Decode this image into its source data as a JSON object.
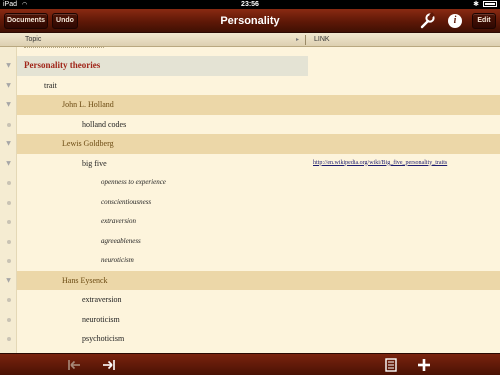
{
  "status_bar": {
    "device": "iPad",
    "time": "23:56"
  },
  "toolbar": {
    "documents_label": "Documents",
    "undo_label": "Undo",
    "title": "Personality",
    "edit_label": "Edit",
    "settings_icon": "wrench-icon",
    "info_icon": "info-icon"
  },
  "columns": {
    "topic": "Topic",
    "link": "LINK"
  },
  "colors": {
    "accent": "#6a1a08",
    "heading_text": "#a0261a",
    "band": "#ecd7a8",
    "heading_band": "#e4e3d4",
    "link": "#1a1a6e"
  },
  "rows": [
    {
      "text": "Personality theories",
      "link": ""
    },
    {
      "text": "trait",
      "link": ""
    },
    {
      "text": "John L. Holland",
      "link": ""
    },
    {
      "text": "holland codes",
      "link": ""
    },
    {
      "text": "Lewis Goldberg",
      "link": ""
    },
    {
      "text": "big five",
      "link": "http://en.wikipedia.org/wiki/Big_five_personality_traits"
    },
    {
      "text": "openness to experience",
      "link": ""
    },
    {
      "text": "conscientiousness",
      "link": ""
    },
    {
      "text": "extraversion",
      "link": ""
    },
    {
      "text": "agreeableness",
      "link": ""
    },
    {
      "text": "neuroticism",
      "link": ""
    },
    {
      "text": "Hans Eysenck",
      "link": ""
    },
    {
      "text": "extraversion",
      "link": ""
    },
    {
      "text": "neuroticism",
      "link": ""
    },
    {
      "text": "psychoticism",
      "link": ""
    }
  ],
  "bottom_toolbar": {
    "outdent_icon": "outdent-icon",
    "indent_icon": "indent-icon",
    "notes_icon": "notes-icon",
    "add_icon": "add-icon"
  }
}
